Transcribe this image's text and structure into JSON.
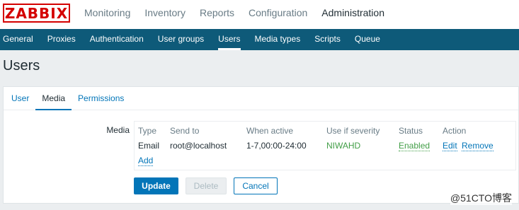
{
  "logo": {
    "text": "ZABBIX",
    "color": "#d40000"
  },
  "main_nav": [
    "Monitoring",
    "Inventory",
    "Reports",
    "Configuration",
    "Administration"
  ],
  "main_nav_active": "Administration",
  "sub_nav": [
    "General",
    "Proxies",
    "Authentication",
    "User groups",
    "Users",
    "Media types",
    "Scripts",
    "Queue"
  ],
  "sub_nav_active": "Users",
  "page_title": "Users",
  "tabs": [
    "User",
    "Media",
    "Permissions"
  ],
  "active_tab": "Media",
  "media": {
    "label": "Media",
    "headers": {
      "type": "Type",
      "send_to": "Send to",
      "when_active": "When active",
      "severity": "Use if severity",
      "status": "Status",
      "action": "Action"
    },
    "row": {
      "type": "Email",
      "send_to": "root@localhost",
      "when_active": "1-7,00:00-24:00",
      "severity": "NIWAHD",
      "status": "Enabled",
      "edit": "Edit",
      "remove": "Remove"
    },
    "add_label": "Add"
  },
  "buttons": {
    "update": "Update",
    "delete": "Delete",
    "cancel": "Cancel"
  },
  "watermark": "@51CTO博客",
  "colors": {
    "brand_red": "#d40000",
    "nav_bg": "#0e5a79",
    "accent_blue": "#0275b8",
    "status_green": "#429e47"
  }
}
